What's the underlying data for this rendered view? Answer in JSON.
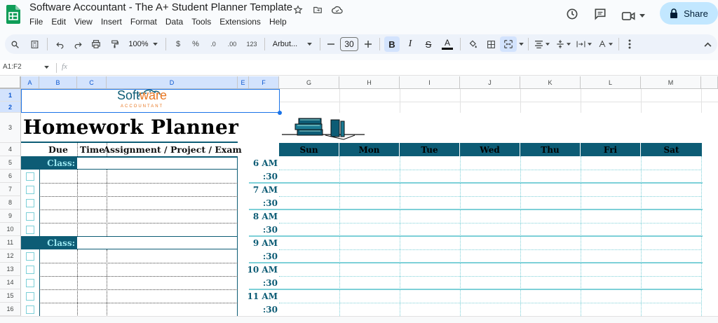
{
  "app": {
    "title": "Software Accountant - The A+ Student Planner Template",
    "menu": [
      "File",
      "Edit",
      "View",
      "Insert",
      "Format",
      "Data",
      "Tools",
      "Extensions",
      "Help"
    ],
    "share_label": "Share"
  },
  "toolbar": {
    "zoom": "100%",
    "currency": "$",
    "percent": "%",
    "dec_decrease": ".0",
    "dec_increase": ".00",
    "number_format": "123",
    "font": "Arbut...",
    "font_size": "30",
    "bold": "B",
    "italic": "I",
    "strike": "S",
    "text_color": "A"
  },
  "formula_bar": {
    "name_box": "A1:F2",
    "fx_label": "fx"
  },
  "columns": {
    "left": [
      "A",
      "B",
      "C",
      "D",
      "E",
      "F"
    ],
    "right": [
      "G",
      "H",
      "I",
      "J",
      "K",
      "L",
      "M"
    ]
  },
  "rows": [
    "1",
    "2",
    "3",
    "4",
    "5",
    "6",
    "7",
    "8",
    "9",
    "10",
    "11",
    "12",
    "13",
    "14",
    "15",
    "16"
  ],
  "planner": {
    "logo_text_a": "Soft",
    "logo_text_b": "ware",
    "logo_sub": "ACCOUNTANT",
    "title": "Homework Planner",
    "headers": {
      "due": "Due",
      "time": "Time",
      "assignment": "Assignment / Project / Exam"
    },
    "class_label": "Class:",
    "days": [
      "Sun",
      "Mon",
      "Tue",
      "Wed",
      "Thu",
      "Fri",
      "Sat"
    ],
    "times": [
      "6 AM",
      ":30",
      "7 AM",
      ":30",
      "8 AM",
      ":30",
      "9 AM",
      ":30",
      "10 AM",
      ":30",
      "11 AM",
      ":30"
    ]
  },
  "colors": {
    "accent": "#0d5c75",
    "class_text": "#9be7f0",
    "checkbox": "#7dd0d8",
    "share_bg": "#c2e7ff"
  }
}
